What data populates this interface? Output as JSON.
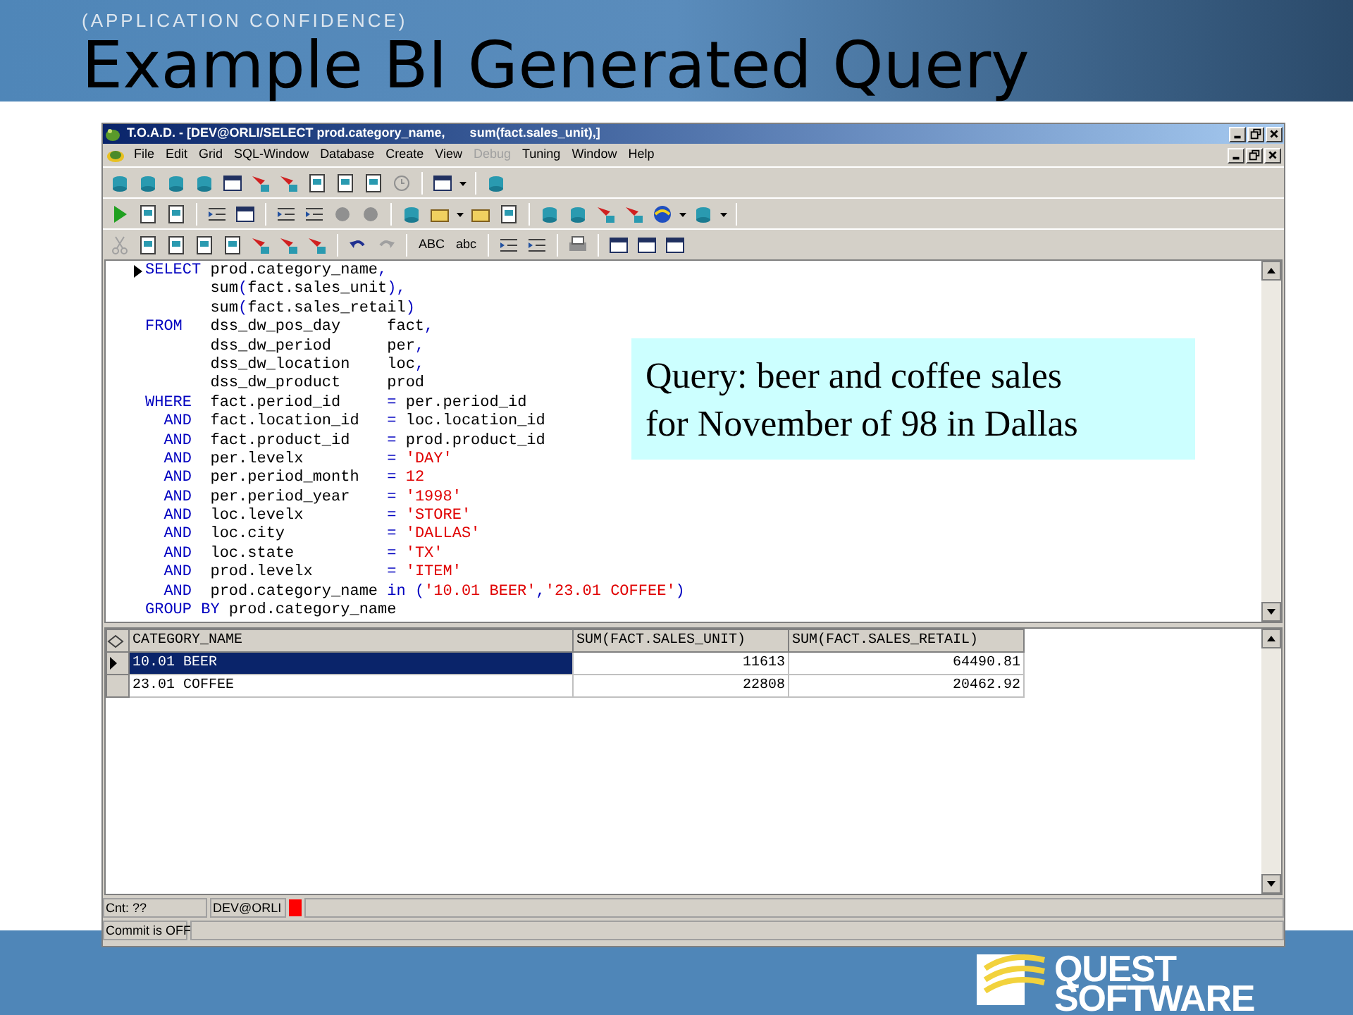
{
  "slide": {
    "tagline": "(APPLICATION CONFIDENCE)",
    "title": "Example BI Generated Query",
    "logo_lines": [
      "QUEST",
      "SOFTWARE"
    ]
  },
  "window": {
    "title": "T.O.A.D. - [DEV@ORLI/SELECT prod.category_name,       sum(fact.sales_unit),]"
  },
  "menu": [
    {
      "label": "File",
      "disabled": false
    },
    {
      "label": "Edit",
      "disabled": false
    },
    {
      "label": "Grid",
      "disabled": false
    },
    {
      "label": "SQL-Window",
      "disabled": false
    },
    {
      "label": "Database",
      "disabled": false
    },
    {
      "label": "Create",
      "disabled": false
    },
    {
      "label": "View",
      "disabled": false
    },
    {
      "label": "Debug",
      "disabled": true
    },
    {
      "label": "Tuning",
      "disabled": false
    },
    {
      "label": "Window",
      "disabled": false
    },
    {
      "label": "Help",
      "disabled": false
    }
  ],
  "toolbar_text_buttons": [
    "ABC",
    "abc"
  ],
  "editor": {
    "lines": [
      {
        "current": true,
        "tokens": [
          {
            "kind": "kw",
            "text": "SELECT"
          },
          {
            "kind": "plain",
            "text": " prod.category_name"
          },
          {
            "kind": "op",
            "text": ","
          }
        ]
      },
      {
        "current": false,
        "tokens": [
          {
            "kind": "plain",
            "text": "       sum"
          },
          {
            "kind": "op",
            "text": "("
          },
          {
            "kind": "plain",
            "text": "fact.sales_unit"
          },
          {
            "kind": "op",
            "text": "),"
          }
        ]
      },
      {
        "current": false,
        "tokens": [
          {
            "kind": "plain",
            "text": "       sum"
          },
          {
            "kind": "op",
            "text": "("
          },
          {
            "kind": "plain",
            "text": "fact.sales_retail"
          },
          {
            "kind": "op",
            "text": ")"
          }
        ]
      },
      {
        "current": false,
        "tokens": [
          {
            "kind": "kw",
            "text": "FROM"
          },
          {
            "kind": "plain",
            "text": "   dss_dw_pos_day     fact"
          },
          {
            "kind": "op",
            "text": ","
          }
        ]
      },
      {
        "current": false,
        "tokens": [
          {
            "kind": "plain",
            "text": "       dss_dw_period      per"
          },
          {
            "kind": "op",
            "text": ","
          }
        ]
      },
      {
        "current": false,
        "tokens": [
          {
            "kind": "plain",
            "text": "       dss_dw_location    loc"
          },
          {
            "kind": "op",
            "text": ","
          }
        ]
      },
      {
        "current": false,
        "tokens": [
          {
            "kind": "plain",
            "text": "       dss_dw_product     prod"
          }
        ]
      },
      {
        "current": false,
        "tokens": [
          {
            "kind": "kw",
            "text": "WHERE"
          },
          {
            "kind": "plain",
            "text": "  fact.period_id     "
          },
          {
            "kind": "op",
            "text": "="
          },
          {
            "kind": "plain",
            "text": " per.period_id"
          }
        ]
      },
      {
        "current": false,
        "tokens": [
          {
            "kind": "kw",
            "text": "  AND"
          },
          {
            "kind": "plain",
            "text": "  fact.location_id   "
          },
          {
            "kind": "op",
            "text": "="
          },
          {
            "kind": "plain",
            "text": " loc.location_id"
          }
        ]
      },
      {
        "current": false,
        "tokens": [
          {
            "kind": "kw",
            "text": "  AND"
          },
          {
            "kind": "plain",
            "text": "  fact.product_id    "
          },
          {
            "kind": "op",
            "text": "="
          },
          {
            "kind": "plain",
            "text": " prod.product_id"
          }
        ]
      },
      {
        "current": false,
        "tokens": [
          {
            "kind": "kw",
            "text": "  AND"
          },
          {
            "kind": "plain",
            "text": "  per.levelx         "
          },
          {
            "kind": "op",
            "text": "="
          },
          {
            "kind": "str",
            "text": " 'DAY'"
          }
        ]
      },
      {
        "current": false,
        "tokens": [
          {
            "kind": "kw",
            "text": "  AND"
          },
          {
            "kind": "plain",
            "text": "  per.period_month   "
          },
          {
            "kind": "op",
            "text": "="
          },
          {
            "kind": "str",
            "text": " 12"
          }
        ]
      },
      {
        "current": false,
        "tokens": [
          {
            "kind": "kw",
            "text": "  AND"
          },
          {
            "kind": "plain",
            "text": "  per.period_year    "
          },
          {
            "kind": "op",
            "text": "="
          },
          {
            "kind": "str",
            "text": " '1998'"
          }
        ]
      },
      {
        "current": false,
        "tokens": [
          {
            "kind": "kw",
            "text": "  AND"
          },
          {
            "kind": "plain",
            "text": "  loc.levelx         "
          },
          {
            "kind": "op",
            "text": "="
          },
          {
            "kind": "str",
            "text": " 'STORE'"
          }
        ]
      },
      {
        "current": false,
        "tokens": [
          {
            "kind": "kw",
            "text": "  AND"
          },
          {
            "kind": "plain",
            "text": "  loc.city           "
          },
          {
            "kind": "op",
            "text": "="
          },
          {
            "kind": "str",
            "text": " 'DALLAS'"
          }
        ]
      },
      {
        "current": false,
        "tokens": [
          {
            "kind": "kw",
            "text": "  AND"
          },
          {
            "kind": "plain",
            "text": "  loc.state          "
          },
          {
            "kind": "op",
            "text": "="
          },
          {
            "kind": "str",
            "text": " 'TX'"
          }
        ]
      },
      {
        "current": false,
        "tokens": [
          {
            "kind": "kw",
            "text": "  AND"
          },
          {
            "kind": "plain",
            "text": "  prod.levelx        "
          },
          {
            "kind": "op",
            "text": "="
          },
          {
            "kind": "str",
            "text": " 'ITEM'"
          }
        ]
      },
      {
        "current": false,
        "tokens": [
          {
            "kind": "kw",
            "text": "  AND"
          },
          {
            "kind": "plain",
            "text": "  prod.category_name "
          },
          {
            "kind": "op",
            "text": "in ("
          },
          {
            "kind": "str",
            "text": "'10.01 BEER'"
          },
          {
            "kind": "op",
            "text": ","
          },
          {
            "kind": "str",
            "text": "'23.01 COFFEE'"
          },
          {
            "kind": "op",
            "text": ")"
          }
        ]
      },
      {
        "current": false,
        "tokens": [
          {
            "kind": "kw",
            "text": "GROUP BY"
          },
          {
            "kind": "plain",
            "text": " prod.category_name"
          }
        ]
      }
    ]
  },
  "callout": {
    "lines": [
      "Query: beer and coffee sales",
      "for November of 98 in Dallas"
    ]
  },
  "results": {
    "columns": [
      "CATEGORY_NAME",
      "SUM(FACT.SALES_UNIT)",
      "SUM(FACT.SALES_RETAIL)"
    ],
    "rows": [
      {
        "selected": true,
        "cells": [
          "10.01 BEER",
          "11613",
          "64490.81"
        ]
      },
      {
        "selected": false,
        "cells": [
          "23.01 COFFEE",
          "22808",
          "20462.92"
        ]
      }
    ]
  },
  "status_bar": {
    "count": "Cnt: ??",
    "connection": "DEV@ORLI",
    "commit": "Commit is OFF"
  }
}
